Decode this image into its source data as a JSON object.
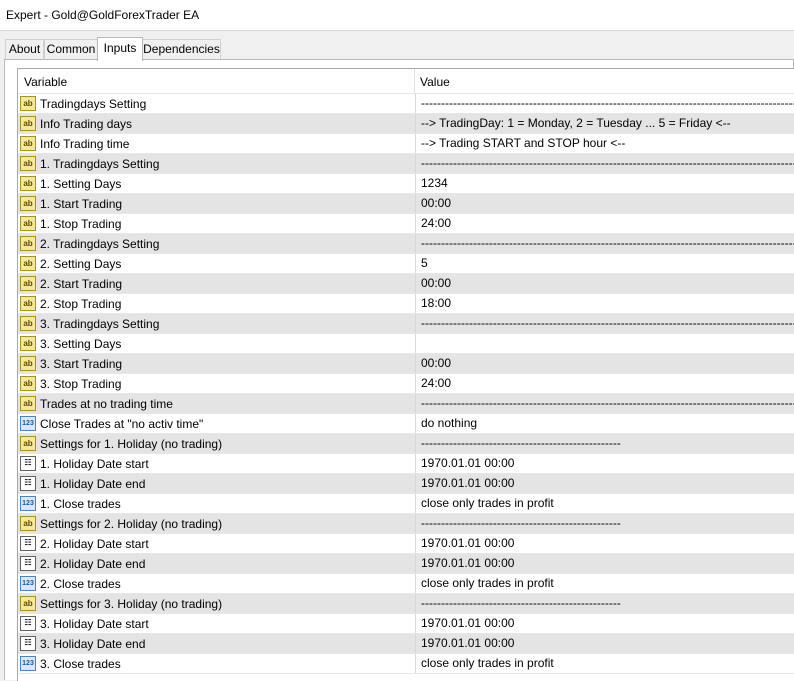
{
  "window": {
    "title": "Expert - Gold@GoldForexTrader EA"
  },
  "tabs": [
    "About",
    "Common",
    "Inputs",
    "Dependencies"
  ],
  "active_tab": "Inputs",
  "table": {
    "headers": {
      "variable": "Variable",
      "value": "Value"
    },
    "rows": [
      {
        "icon": "ab",
        "variable": "Tradingdays Setting",
        "value": "-----------------------------------------------------------------------------------------------------"
      },
      {
        "icon": "ab",
        "variable": "Info Trading days",
        "value": "-->  TradingDay: 1 = Monday, 2 = Tuesday ... 5 = Friday <--"
      },
      {
        "icon": "ab",
        "variable": "Info Trading time",
        "value": "-->  Trading START and STOP hour   <--"
      },
      {
        "icon": "ab",
        "variable": "1. Tradingdays Setting",
        "value": "-----------------------------------------------------------------------------------------------------"
      },
      {
        "icon": "ab",
        "variable": "1. Setting Days",
        "value": "1234"
      },
      {
        "icon": "ab",
        "variable": "1. Start Trading",
        "value": "00:00"
      },
      {
        "icon": "ab",
        "variable": "1. Stop Trading",
        "value": "24:00"
      },
      {
        "icon": "ab",
        "variable": "2. Tradingdays Setting",
        "value": "-----------------------------------------------------------------------------------------------------"
      },
      {
        "icon": "ab",
        "variable": "2. Setting Days",
        "value": "5"
      },
      {
        "icon": "ab",
        "variable": "2. Start Trading",
        "value": "00:00"
      },
      {
        "icon": "ab",
        "variable": "2. Stop Trading",
        "value": "18:00"
      },
      {
        "icon": "ab",
        "variable": "3. Tradingdays Setting",
        "value": "-----------------------------------------------------------------------------------------------------"
      },
      {
        "icon": "ab",
        "variable": "3. Setting Days",
        "value": ""
      },
      {
        "icon": "ab",
        "variable": "3. Start Trading",
        "value": "00:00"
      },
      {
        "icon": "ab",
        "variable": "3. Stop Trading",
        "value": "24:00"
      },
      {
        "icon": "ab",
        "variable": "Trades at no trading time",
        "value": "-----------------------------------------------------------------------------------------------------"
      },
      {
        "icon": "num",
        "variable": "Close Trades at \"no activ time\"",
        "value": "do nothing"
      },
      {
        "icon": "ab",
        "variable": "Settings for 1. Holiday (no trading)",
        "value": "--------------------------------------------------"
      },
      {
        "icon": "cal",
        "variable": "1. Holiday Date start",
        "value": "1970.01.01 00:00"
      },
      {
        "icon": "cal",
        "variable": "1. Holiday Date end",
        "value": "1970.01.01 00:00"
      },
      {
        "icon": "num",
        "variable": "1. Close trades",
        "value": "close only trades in profit"
      },
      {
        "icon": "ab",
        "variable": "Settings for 2. Holiday (no trading)",
        "value": "--------------------------------------------------"
      },
      {
        "icon": "cal",
        "variable": "2. Holiday Date start",
        "value": "1970.01.01 00:00"
      },
      {
        "icon": "cal",
        "variable": "2. Holiday Date end",
        "value": "1970.01.01 00:00"
      },
      {
        "icon": "num",
        "variable": "2. Close trades",
        "value": "close only trades in profit"
      },
      {
        "icon": "ab",
        "variable": "Settings for 3. Holiday (no trading)",
        "value": "--------------------------------------------------"
      },
      {
        "icon": "cal",
        "variable": "3. Holiday Date start",
        "value": "1970.01.01 00:00"
      },
      {
        "icon": "cal",
        "variable": "3. Holiday Date end",
        "value": "1970.01.01 00:00"
      },
      {
        "icon": "num",
        "variable": "3. Close trades",
        "value": "close only trades in profit"
      }
    ]
  }
}
